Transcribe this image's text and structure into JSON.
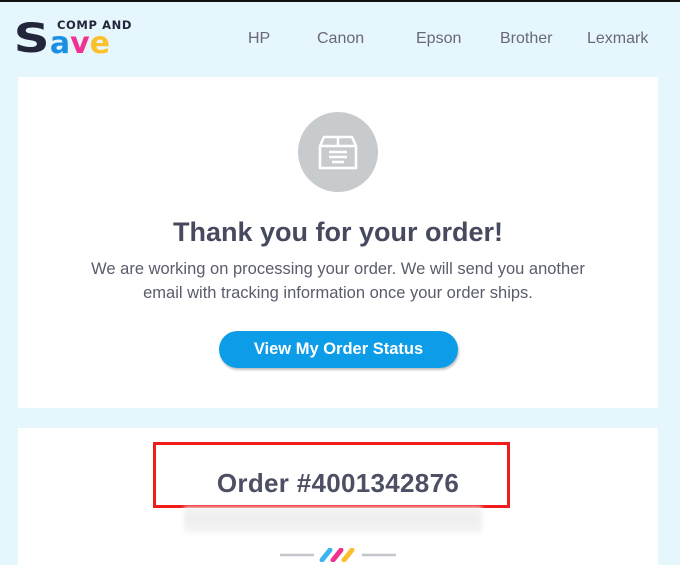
{
  "brand": {
    "name_small": "COMP AND",
    "name_big": [
      "S",
      "a",
      "v",
      "e"
    ],
    "logo_colors": {
      "dark": "#23253a",
      "blue": "#1b8fe3",
      "pink": "#f0338f",
      "yellow": "#fbc02d"
    }
  },
  "nav": {
    "items": [
      {
        "label": "HP"
      },
      {
        "label": "Canon"
      },
      {
        "label": "Epson"
      },
      {
        "label": "Brother"
      },
      {
        "label": "Lexmark"
      }
    ]
  },
  "confirmation": {
    "icon": "package-box-icon",
    "title": "Thank you for your order!",
    "message": "We are working on processing your order. We will send you another email with tracking information once your order ships.",
    "button_label": "View My Order Status"
  },
  "order": {
    "number_label": "Order #4001342876",
    "highlight_color": "#ee1c1c"
  },
  "colors": {
    "page_background": "#e6f6fd",
    "accent": "#0d9ce8",
    "heading_text": "#474a5e"
  }
}
